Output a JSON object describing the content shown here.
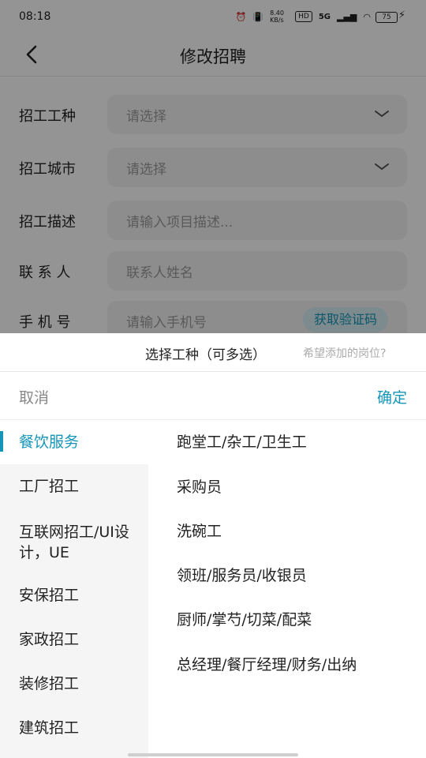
{
  "status_bar": {
    "time": "08:18",
    "net_speed": "8.40 KB/s",
    "hd": "HD",
    "signal": "5G",
    "battery": "75"
  },
  "header": {
    "title": "修改招聘",
    "back_icon": "chevron-left-icon"
  },
  "form": {
    "rows": [
      {
        "label": "招工工种",
        "placeholder": "请选择",
        "type": "select"
      },
      {
        "label": "招工城市",
        "placeholder": "请选择",
        "type": "select"
      },
      {
        "label": "招工描述",
        "placeholder": "请输入项目描述..."
      },
      {
        "label": "联 系 人",
        "placeholder": "联系人姓名"
      },
      {
        "label": "手 机 号",
        "placeholder": "请输入手机号",
        "button": "获取验证码"
      }
    ]
  },
  "sheet": {
    "title": "选择工种（可多选）",
    "hint": "希望添加的岗位?",
    "cancel": "取消",
    "confirm": "确定",
    "categories": [
      "餐饮服务",
      "工厂招工",
      "互联网招工/UI设计，UE",
      "安保招工",
      "家政招工",
      "装修招工",
      "建筑招工"
    ],
    "active_category": 0,
    "jobs": [
      "跑堂工/杂工/卫生工",
      "采购员",
      "洗碗工",
      "领班/服务员/收银员",
      "厨师/掌芍/切菜/配菜",
      "总经理/餐厅经理/财务/出纳"
    ]
  },
  "colors": {
    "accent": "#1596b8",
    "field_bg": "#f3f3f3"
  }
}
